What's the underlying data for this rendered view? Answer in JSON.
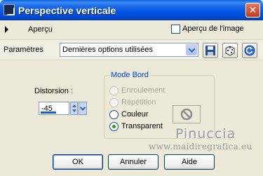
{
  "window": {
    "title": "Perspective verticale",
    "close_glyph": "✕"
  },
  "preview": {
    "label": "Aperçu",
    "image_preview_label": "Aperçu de l'image",
    "image_preview_checked": false
  },
  "params": {
    "label": "Paramètres",
    "preset_value": "Dernières options utilisées",
    "icons": [
      "save-preset-icon",
      "random-dice-icon",
      "reset-icon"
    ]
  },
  "distortion": {
    "label": "Distorsion :",
    "value": "-45"
  },
  "edge_mode": {
    "title": "Mode Bord",
    "options": [
      {
        "label": "Enroulement",
        "enabled": false,
        "checked": false
      },
      {
        "label": "Répétition",
        "enabled": false,
        "checked": false
      },
      {
        "label": "Couleur",
        "enabled": true,
        "checked": false
      },
      {
        "label": "Transparent",
        "enabled": true,
        "checked": true
      }
    ],
    "color_swatch_icon": "no-color-icon"
  },
  "watermark": {
    "name": "Pinuccia",
    "url": "www.maidiregrafica.eu"
  },
  "buttons": {
    "ok": "OK",
    "cancel": "Annuler",
    "help": "Aide"
  },
  "colors": {
    "title_bar": "#0055e5",
    "close_button": "#d45a3a",
    "group_title": "#0046d5",
    "dialog_bg": "#ece9d8"
  }
}
